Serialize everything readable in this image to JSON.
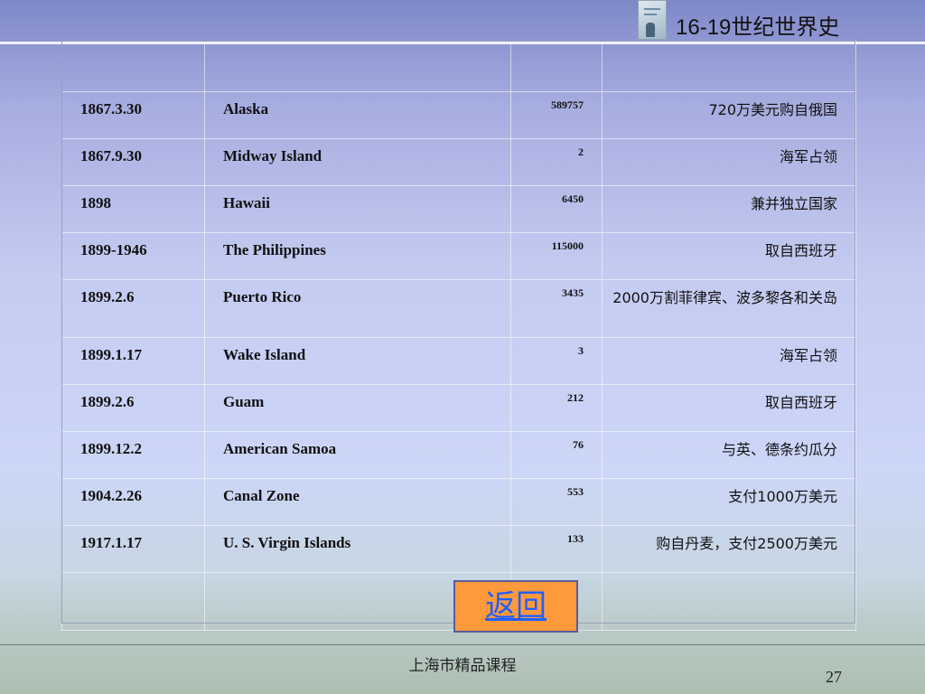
{
  "header": {
    "title": "16-19世纪世界史",
    "logo_icon": "book-cover-icon"
  },
  "table": {
    "rows": [
      {
        "date": "1867.3.30",
        "place": "Alaska",
        "area": "589757",
        "note": "720万美元购自俄国"
      },
      {
        "date": "1867.9.30",
        "place": "Midway Island",
        "area": "2",
        "note": "海军占领"
      },
      {
        "date": "1898",
        "place": "Hawaii",
        "area": "6450",
        "note": "兼并独立国家"
      },
      {
        "date": "1899-1946",
        "place": "The Philippines",
        "area": "115000",
        "note": "取自西班牙"
      },
      {
        "date": "1899.2.6",
        "place": "Puerto Rico",
        "area": "3435",
        "note": "2000万割菲律宾、波多黎各和关岛"
      },
      {
        "date": "1899.1.17",
        "place": "Wake Island",
        "area": "3",
        "note": "海军占领"
      },
      {
        "date": "1899.2.6",
        "place": "Guam",
        "area": "212",
        "note": "取自西班牙"
      },
      {
        "date": "1899.12.2",
        "place": "American Samoa",
        "area": "76",
        "note": "与英、德条约瓜分"
      },
      {
        "date": "1904.2.26",
        "place": "Canal Zone",
        "area": "553",
        "note": "支付1000万美元"
      },
      {
        "date": "1917.1.17",
        "place": "U. S. Virgin Islands",
        "area": "133",
        "note": "购自丹麦，支付2500万美元"
      }
    ]
  },
  "back_button": {
    "label": "返回"
  },
  "footer": {
    "text": "上海市精品课程",
    "page_number": "27"
  }
}
